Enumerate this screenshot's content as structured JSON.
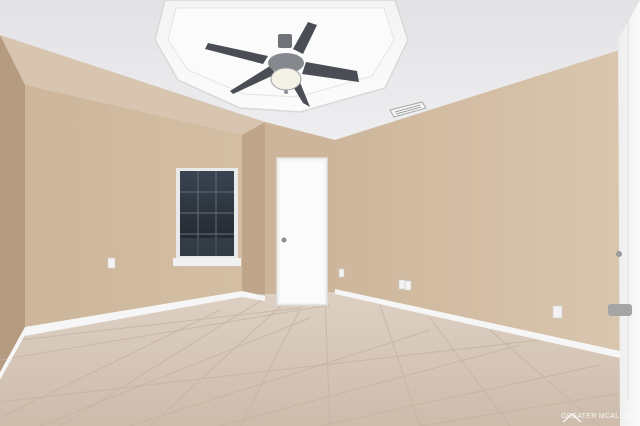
{
  "watermark": {
    "text": "GREATER MCALLEN",
    "icon": "house-roof-icon"
  }
}
